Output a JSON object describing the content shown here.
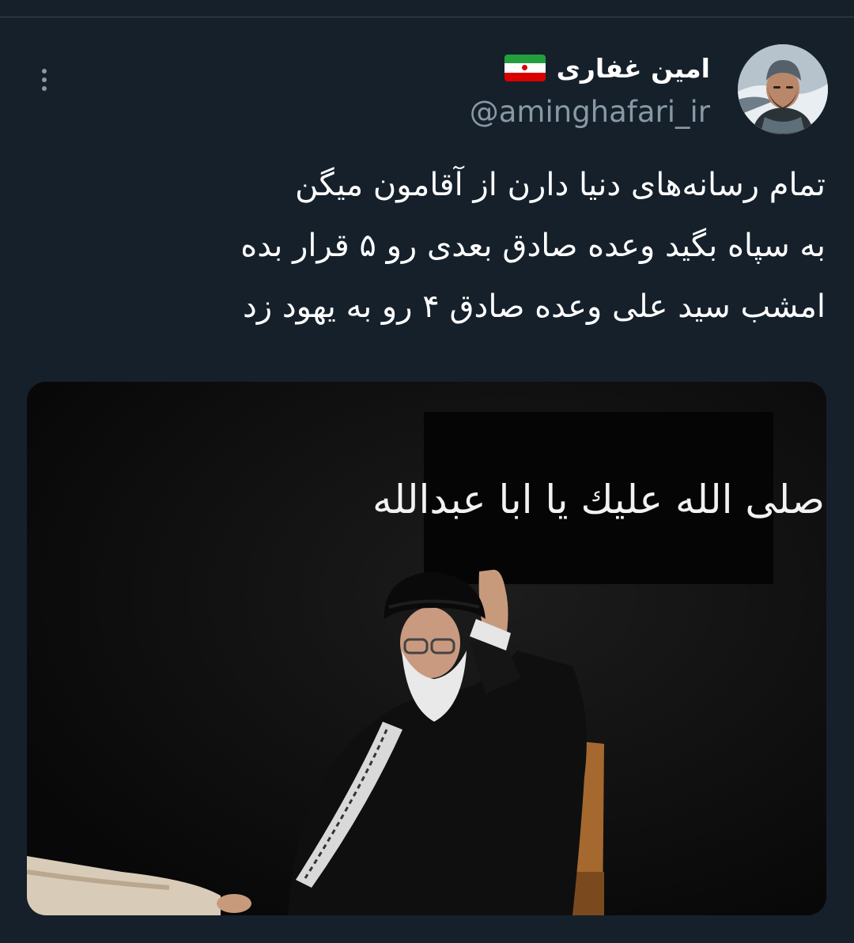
{
  "author": {
    "display_name": "امین غفاری",
    "handle": "@aminghafari_ir",
    "flag_icon": "iran-flag-icon"
  },
  "tweet": {
    "lines": [
      "تمام رسانه‌های دنیا دارن از آقامون میگن",
      "به سپاه بگید وعده صادق بعدی رو ۵ قرار بده",
      "امشب سید علی وعده صادق ۴ رو به یهود زد"
    ]
  },
  "media": {
    "banner_text": "صلى الله عليك يا ابا عبدالله"
  },
  "colors": {
    "background": "#15202b",
    "text_primary": "#ffffff",
    "text_secondary": "#8899a6",
    "divider": "#38444d"
  }
}
